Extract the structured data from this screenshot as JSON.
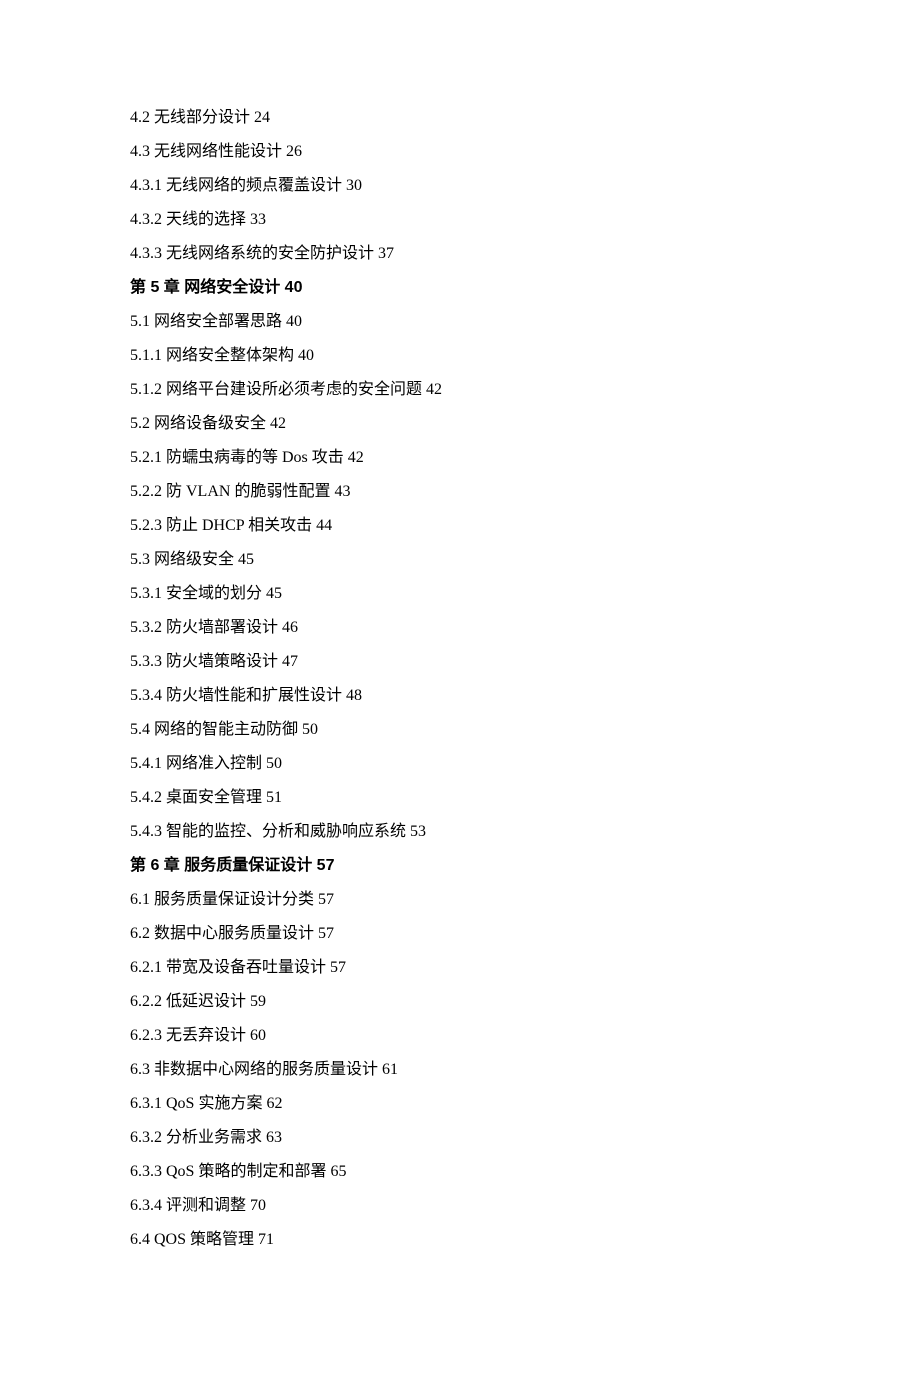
{
  "toc": [
    {
      "text": "4.2 无线部分设计 24",
      "chapter": false
    },
    {
      "text": "4.3 无线网络性能设计 26",
      "chapter": false
    },
    {
      "text": "4.3.1 无线网络的频点覆盖设计 30",
      "chapter": false
    },
    {
      "text": "4.3.2 天线的选择 33",
      "chapter": false
    },
    {
      "text": "4.3.3 无线网络系统的安全防护设计 37",
      "chapter": false
    },
    {
      "text": "第 5 章 网络安全设计 40",
      "chapter": true
    },
    {
      "text": "5.1 网络安全部署思路 40",
      "chapter": false
    },
    {
      "text": "5.1.1 网络安全整体架构 40",
      "chapter": false
    },
    {
      "text": "5.1.2 网络平台建设所必须考虑的安全问题 42",
      "chapter": false
    },
    {
      "text": "5.2 网络设备级安全 42",
      "chapter": false
    },
    {
      "text": "5.2.1 防蠕虫病毒的等 Dos 攻击 42",
      "chapter": false
    },
    {
      "text": "5.2.2 防 VLAN 的脆弱性配置 43",
      "chapter": false
    },
    {
      "text": "5.2.3 防止 DHCP 相关攻击 44",
      "chapter": false
    },
    {
      "text": "5.3 网络级安全 45",
      "chapter": false
    },
    {
      "text": "5.3.1 安全域的划分 45",
      "chapter": false
    },
    {
      "text": "5.3.2 防火墙部署设计 46",
      "chapter": false
    },
    {
      "text": "5.3.3 防火墙策略设计 47",
      "chapter": false
    },
    {
      "text": "5.3.4 防火墙性能和扩展性设计 48",
      "chapter": false
    },
    {
      "text": "5.4 网络的智能主动防御 50",
      "chapter": false
    },
    {
      "text": "5.4.1 网络准入控制 50",
      "chapter": false
    },
    {
      "text": "5.4.2 桌面安全管理 51",
      "chapter": false
    },
    {
      "text": "5.4.3 智能的监控、分析和威胁响应系统 53",
      "chapter": false
    },
    {
      "text": "第 6 章 服务质量保证设计 57",
      "chapter": true
    },
    {
      "text": "6.1 服务质量保证设计分类 57",
      "chapter": false
    },
    {
      "text": "6.2 数据中心服务质量设计 57",
      "chapter": false
    },
    {
      "text": "6.2.1 带宽及设备吞吐量设计 57",
      "chapter": false
    },
    {
      "text": "6.2.2 低延迟设计 59",
      "chapter": false
    },
    {
      "text": "6.2.3 无丢弃设计 60",
      "chapter": false
    },
    {
      "text": "6.3 非数据中心网络的服务质量设计 61",
      "chapter": false
    },
    {
      "text": "6.3.1 QoS 实施方案 62",
      "chapter": false
    },
    {
      "text": "6.3.2 分析业务需求 63",
      "chapter": false
    },
    {
      "text": "6.3.3 QoS 策略的制定和部署 65",
      "chapter": false
    },
    {
      "text": "6.3.4 评测和调整 70",
      "chapter": false
    },
    {
      "text": "6.4 QOS 策略管理 71",
      "chapter": false
    }
  ]
}
